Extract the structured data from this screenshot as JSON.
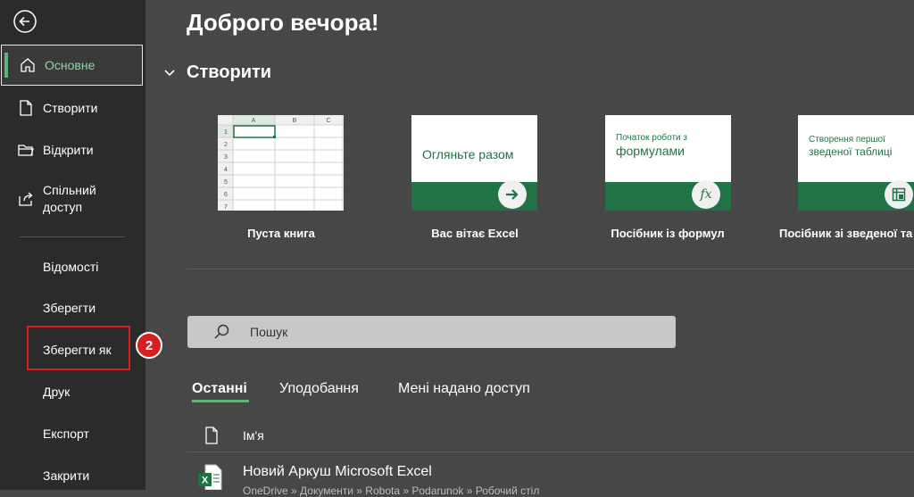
{
  "sidebar": {
    "home": "Основне",
    "new": "Створити",
    "open": "Відкрити",
    "share": "Спільний доступ",
    "info": "Відомості",
    "save": "Зберегти",
    "save_as": "Зберегти як",
    "print": "Друк",
    "export": "Експорт",
    "close": "Закрити"
  },
  "badge": "2",
  "main": {
    "greeting": "Доброго вечора!",
    "create_title": "Створити",
    "templates": [
      {
        "label": "Пуста книга"
      },
      {
        "label": "Вас вітає Excel",
        "thumb_text": "Огляньте разом"
      },
      {
        "label": "Посібник із формул",
        "thumb_text_1": "Початок роботи з",
        "thumb_text_2": "формулами"
      },
      {
        "label": "Посібник зі зведеної та",
        "thumb_text_1": "Створення першої",
        "thumb_text_2": "зведеної таблиці"
      }
    ],
    "blank_grid": {
      "cols": [
        "A",
        "B",
        "C"
      ],
      "rows": [
        "1",
        "2",
        "3",
        "4",
        "5",
        "6",
        "7"
      ]
    },
    "search_placeholder": "Пошук",
    "tabs": [
      "Останні",
      "Уподобання",
      "Мені надано доступ"
    ],
    "column_name": "Ім'я",
    "recent_files": [
      {
        "name": "Новий Аркуш Microsoft Excel",
        "path": "OneDrive » Документи » Robota » Podarunok » Робочий стіл"
      }
    ]
  },
  "colors": {
    "accent": "#217346",
    "highlight": "#d62020"
  }
}
